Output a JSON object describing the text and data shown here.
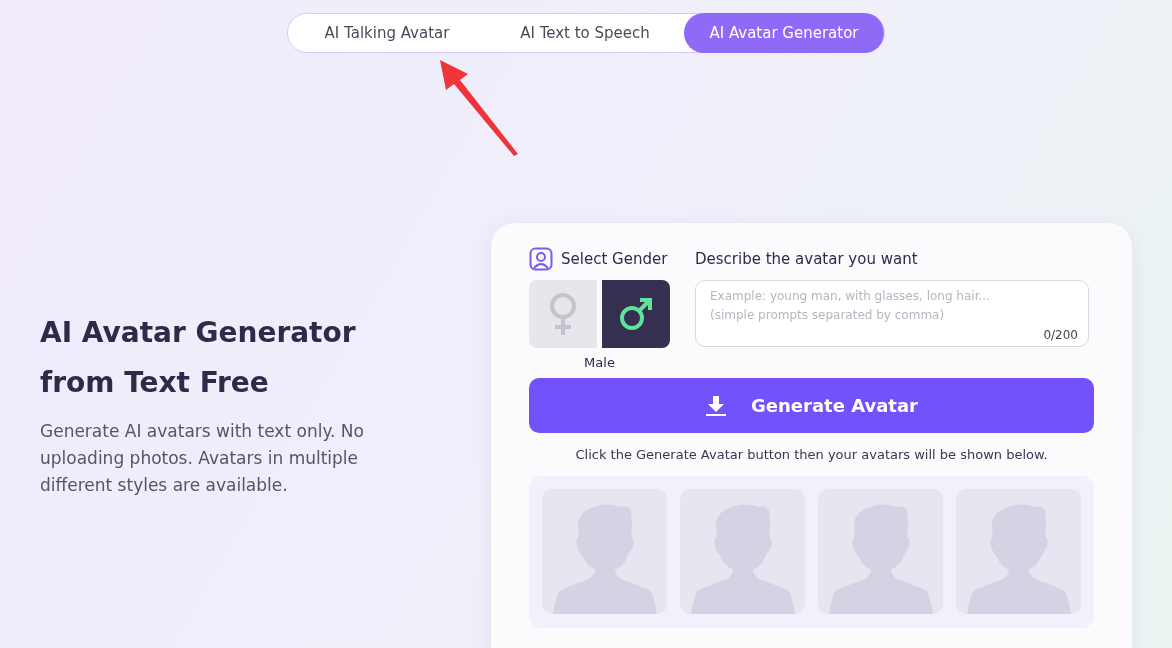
{
  "tabs": [
    {
      "label": "AI Talking Avatar",
      "selected": false
    },
    {
      "label": "AI Text to Speech",
      "selected": false
    },
    {
      "label": "AI Avatar Generator",
      "selected": true
    }
  ],
  "hero": {
    "title_lines": [
      "AI Avatar Generator",
      "from Text Free"
    ],
    "description": "Generate AI avatars with text only. No uploading photos. Avatars in multiple different styles are available."
  },
  "generator": {
    "gender": {
      "label": "Select Gender",
      "options": [
        {
          "kind": "female",
          "selected": false
        },
        {
          "kind": "male",
          "selected": true
        }
      ],
      "caption": "Male"
    },
    "prompt": {
      "label": "Describe the avatar you want",
      "placeholder": "Example: young man, with glasses, long hair...\n(simple prompts separated by comma)",
      "counter": "0/200"
    },
    "button": "Generate Avatar",
    "hint": "Click the Generate Avatar button then your avatars will be shown below.",
    "avatar_slots": [
      {
        "kind": "placeholder"
      },
      {
        "kind": "placeholder"
      },
      {
        "kind": "placeholder"
      },
      {
        "kind": "placeholder"
      }
    ]
  }
}
